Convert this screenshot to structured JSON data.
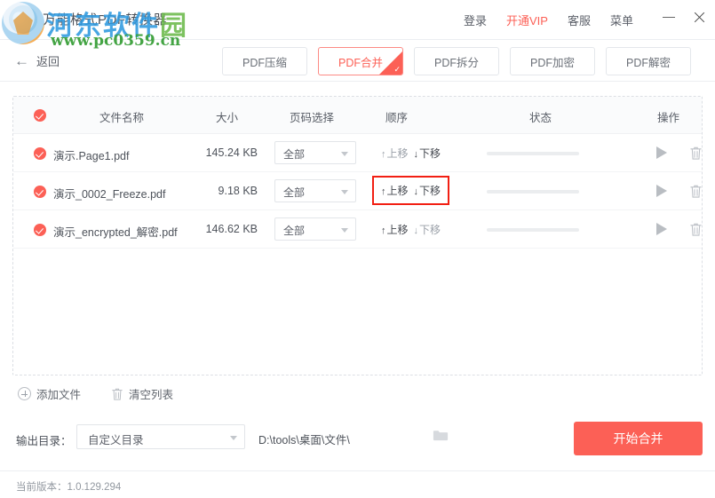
{
  "window": {
    "title": "万能格式PDF转换器",
    "logo_icon": "app-logo-icon",
    "minimize_label": "−",
    "close_label": "✕"
  },
  "header": {
    "items": [
      {
        "label": "登录",
        "name": "login"
      },
      {
        "label": "开通VIP",
        "name": "vip"
      },
      {
        "label": "客服",
        "name": "support"
      },
      {
        "label": "菜单",
        "name": "menu"
      }
    ],
    "vip_color": "#fc6056"
  },
  "toolbar": {
    "back_label": "返回",
    "back_icon": "arrow-left-icon",
    "tabs": [
      {
        "label": "PDF压缩",
        "active": false
      },
      {
        "label": "PDF合并",
        "active": true
      },
      {
        "label": "PDF拆分",
        "active": false
      },
      {
        "label": "PDF加密",
        "active": false
      },
      {
        "label": "PDF解密",
        "active": false
      }
    ]
  },
  "file_table": {
    "select_all_icon": "check-circle-icon",
    "columns": {
      "name": "文件名称",
      "size": "大小",
      "pages": "页码选择",
      "order": "顺序",
      "status": "状态",
      "actions": "操作"
    },
    "move_up_label": "上移",
    "move_down_label": "下移",
    "move_up_icon": "arrow-up-icon",
    "move_down_icon": "arrow-down-icon",
    "play_icon": "play-icon",
    "delete_icon": "trash-icon",
    "rows": [
      {
        "name": "演示.Page1.pdf",
        "size": "145.24 KB",
        "pages": "全部",
        "checked": true,
        "highlight": false
      },
      {
        "name": "演示_0002_Freeze.pdf",
        "size": "9.18 KB",
        "pages": "全部",
        "checked": true,
        "highlight": true
      },
      {
        "name": "演示_encrypted_解密.pdf",
        "size": "146.62 KB",
        "pages": "全部",
        "checked": true,
        "highlight": false
      }
    ],
    "highlight_color": "#f21f13"
  },
  "list_actions": {
    "add_files_label": "添加文件",
    "add_files_icon": "plus-circle-icon",
    "clear_list_label": "清空列表",
    "clear_list_icon": "trash-icon"
  },
  "output": {
    "label": "输出目录：",
    "mode_value": "自定义目录",
    "path": "D:\\tools\\桌面\\文件\\",
    "browse_icon": "folder-icon",
    "start_label": "开始合并",
    "start_color": "#fc6056"
  },
  "footer": {
    "version_text": "当前版本：1.0.129.294"
  },
  "watermark": {
    "site_name_blue": "河东软件",
    "site_name_green": "园",
    "url": "www.pc0359.cn"
  }
}
